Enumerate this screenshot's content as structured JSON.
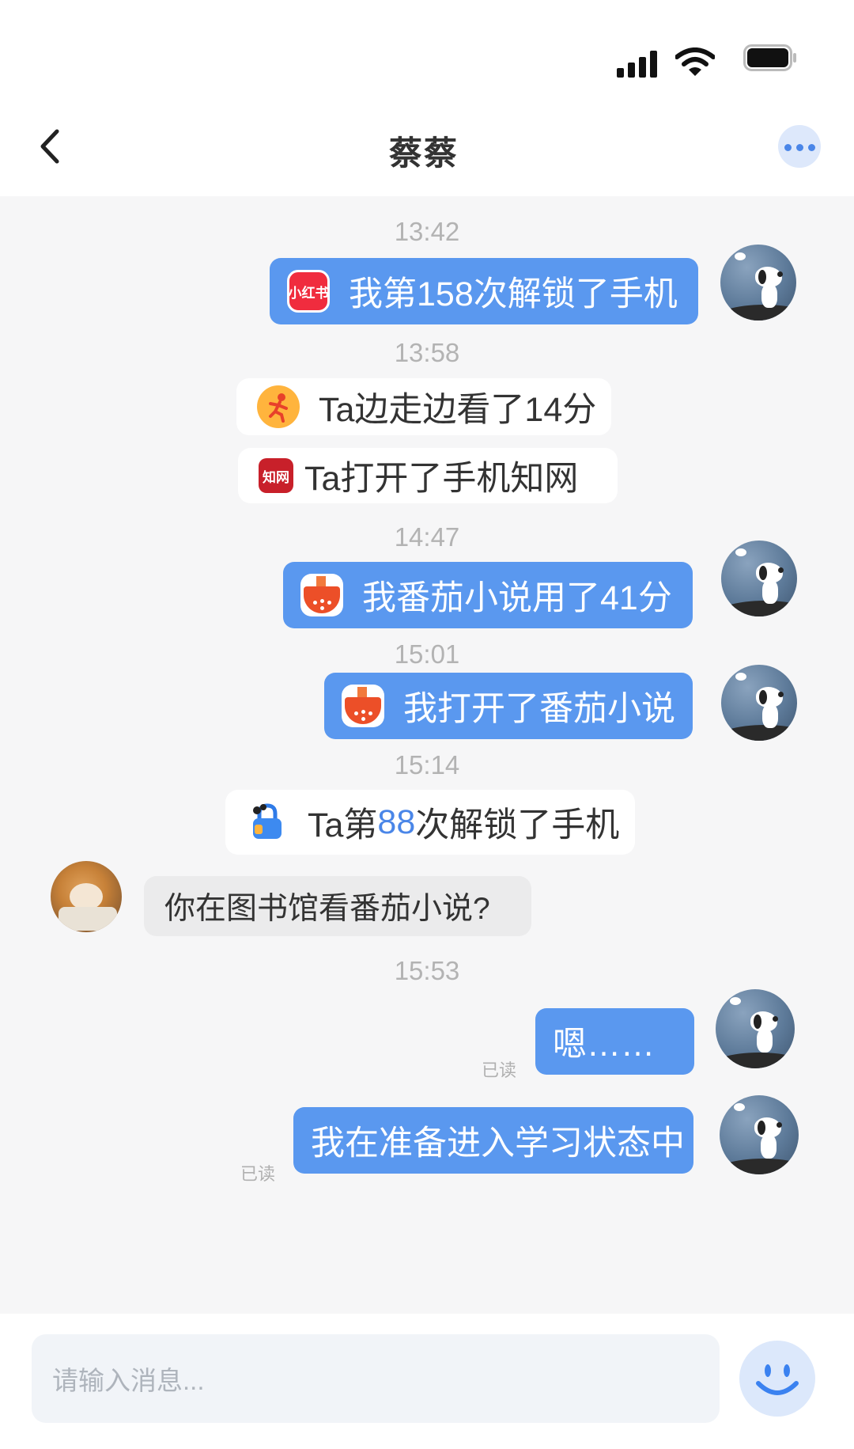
{
  "header": {
    "title": "蔡蔡"
  },
  "messages": {
    "m1": {
      "time": "13:42",
      "text": "我第158次解锁了手机",
      "icon_label": "小红书"
    },
    "m2": {
      "time": "13:58",
      "text": "Ta边走边看了14分"
    },
    "m3": {
      "text": "Ta打开了手机知网",
      "icon_label": "知网"
    },
    "m4": {
      "time": "14:47",
      "text": "我番茄小说用了41分"
    },
    "m5": {
      "time": "15:01",
      "text": "我打开了番茄小说"
    },
    "m6": {
      "time": "15:14",
      "text_pre": "Ta第",
      "count": "88",
      "text_post": "次解锁了手机",
      "count_color": "#4a86e8"
    },
    "m7": {
      "text": "你在图书馆看番茄小说?"
    },
    "m8": {
      "time": "15:53",
      "text": "嗯……",
      "status": "已读"
    },
    "m9": {
      "text": "我在准备进入学习状态中",
      "status": "已读"
    }
  },
  "input": {
    "placeholder": "请输入消息..."
  },
  "colors": {
    "bubble_me": "#5a98ef",
    "accent": "#4a86e8"
  },
  "icons": {
    "back": "chevron-left-icon",
    "more": "more-dots-icon",
    "emoji": "smiley-icon",
    "status": [
      "signal-icon",
      "wifi-icon",
      "battery-icon"
    ]
  }
}
